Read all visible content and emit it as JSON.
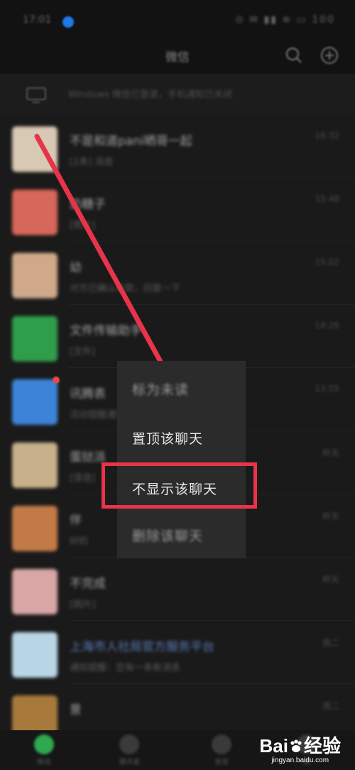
{
  "status_bar": {
    "time": "17:01",
    "indicators": "⊙ ✉ ▮▮ ≋ ▭ 100"
  },
  "header": {
    "title": "微信"
  },
  "login_notice": {
    "text": "Windows 微信已登录，手机通知已关闭"
  },
  "chats": [
    {
      "name": "不是和道pani晒哥一起",
      "preview": "[1条] 消息",
      "time": "16:32",
      "avatar_color": "#d8c9b4",
      "badge": false,
      "link": false
    },
    {
      "name": "奶糖子",
      "preview": "[图片]",
      "time": "15:48",
      "avatar_color": "#d6675a",
      "badge": false,
      "link": false
    },
    {
      "name": "幼",
      "preview": "对方已确认收款，回复一下",
      "time": "15:02",
      "avatar_color": "#cfa98a",
      "badge": false,
      "link": false
    },
    {
      "name": "文件传输助手",
      "preview": "[文件]",
      "time": "14:26",
      "avatar_color": "#2f9e4a",
      "badge": false,
      "link": false
    },
    {
      "name": "讯腾表",
      "preview": "活动提醒通知",
      "time": "13:55",
      "avatar_color": "#3d84d8",
      "badge": true,
      "link": false
    },
    {
      "name": "蛋挞派",
      "preview": "[语音]",
      "time": "昨天",
      "avatar_color": "#c8b08a",
      "badge": false,
      "link": false
    },
    {
      "name": "伴",
      "preview": "好的",
      "time": "昨天",
      "avatar_color": "#c27a46",
      "badge": false,
      "link": false
    },
    {
      "name": "不完成",
      "preview": "[图片]",
      "time": "昨天",
      "avatar_color": "#d9a6a6",
      "badge": false,
      "link": false
    },
    {
      "name": "上海市人社局官方服务平台",
      "preview": "通知提醒：您有一条新消息",
      "time": "周二",
      "avatar_color": "#b8d6e6",
      "badge": false,
      "link": true
    },
    {
      "name": "景",
      "preview": "",
      "time": "周二",
      "avatar_color": "#a77a3c",
      "badge": false,
      "link": false
    }
  ],
  "tabs": [
    {
      "label": "微信",
      "color": "#2fa84f"
    },
    {
      "label": "通讯录",
      "color": "#3a3a3a"
    },
    {
      "label": "发现",
      "color": "#3a3a3a"
    },
    {
      "label": "我",
      "color": "#3a3a3a"
    }
  ],
  "context_menu": {
    "items": [
      {
        "label": "标为未读",
        "blurred": true
      },
      {
        "label": "置顶该聊天",
        "blurred": false
      },
      {
        "label": "不显示该聊天",
        "blurred": false
      },
      {
        "label": "删除该聊天",
        "blurred": true
      }
    ]
  },
  "annotation": {
    "color": "#e8344a"
  },
  "watermark": {
    "brand_prefix": "Bai",
    "brand_suffix": "经验",
    "url": "jingyan.baidu.com"
  }
}
